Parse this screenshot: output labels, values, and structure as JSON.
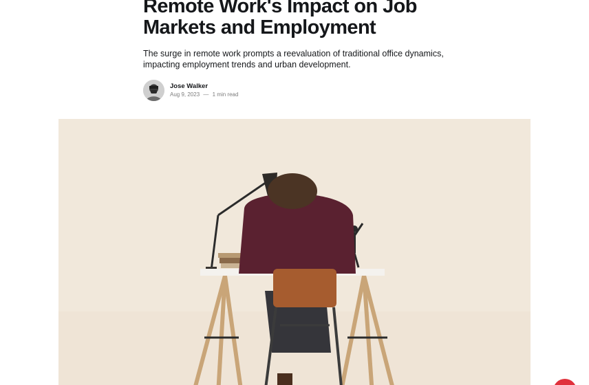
{
  "article": {
    "title": "Remote Work's Impact on Job Markets and Employment",
    "excerpt": "The surge in remote work prompts a reevaluation of traditional office dynamics, impacting employment trends and urban development.",
    "author": {
      "name": "Jose Walker",
      "avatar_icon": "author-avatar"
    },
    "date": "Aug 9, 2023",
    "separator": "—",
    "reading_time": "1 min read"
  },
  "feature_image": {
    "description_icon": "photo-person-at-desk"
  },
  "colors": {
    "accent": "#e0313c",
    "text": "#15171a",
    "muted": "#7c7c7c",
    "image_background": "#f1e8db"
  }
}
